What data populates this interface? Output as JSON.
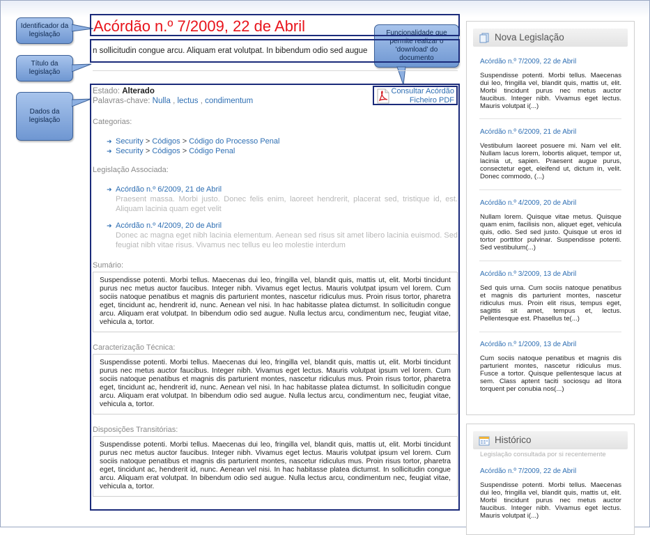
{
  "callouts": {
    "identificador": "Identificador da legislação",
    "titulo": "Título da legislação",
    "dados": "Dados da legislação",
    "funcionalidade": "Funcionalidade que permite realizar o 'download' do documento"
  },
  "document": {
    "title": "Acórdão n.º 7/2009, 22 de Abril",
    "subtitle": "n sollicitudin congue arcu. Aliquam erat volutpat. In bibendum odio sed augue",
    "estado_label": "Estado:",
    "estado_value": "Alterado",
    "keywords_label": "Palavras-chave:",
    "keywords": [
      "Nulla",
      "lectus",
      "condimentum"
    ],
    "pdf_link1": "Consultar Acórdão",
    "pdf_link2": "Ficheiro PDF",
    "categorias_label": "Categorias:",
    "categorias": [
      [
        "Security",
        "Códigos",
        "Código do Processo Penal"
      ],
      [
        "Security",
        "Códigos",
        "Código Penal"
      ]
    ],
    "associada_label": "Legislação Associada:",
    "associada": [
      {
        "title": "Acórdão n.º 6/2009, 21 de Abril",
        "desc": "Praesent massa. Morbi justo. Donec felis enim, laoreet hendrerit, placerat sed, tristique id, est. Aliquam lacinia quam eget velit"
      },
      {
        "title": "Acórdão n.º 4/2009, 20 de Abril",
        "desc": "Donec ac magna eget nibh lacinia elementum. Aenean sed risus sit amet libero lacinia euismod. Sed feugiat nibh vitae risus. Vivamus nec tellus eu leo molestie interdum"
      }
    ],
    "sumario_label": "Sumário:",
    "sumario": "Suspendisse potenti. Morbi tellus. Maecenas dui leo, fringilla vel, blandit quis, mattis ut, elit. Morbi tincidunt purus nec metus auctor faucibus. Integer nibh. Vivamus eget lectus. Mauris volutpat ipsum vel lorem. Cum sociis natoque penatibus et magnis dis parturient montes, nascetur ridiculus mus. Proin risus tortor, pharetra eget, tincidunt ac, hendrerit id, nunc. Aenean vel nisi. In hac habitasse platea dictumst. In sollicitudin congue arcu. Aliquam erat volutpat. In bibendum odio sed augue. Nulla lectus arcu, condimentum nec, feugiat vitae, vehicula a, tortor.",
    "caracterizacao_label": "Caracterização Técnica:",
    "caracterizacao": "Suspendisse potenti. Morbi tellus. Maecenas dui leo, fringilla vel, blandit quis, mattis ut, elit. Morbi tincidunt purus nec metus auctor faucibus. Integer nibh. Vivamus eget lectus. Mauris volutpat ipsum vel lorem. Cum sociis natoque penatibus et magnis dis parturient montes, nascetur ridiculus mus. Proin risus tortor, pharetra eget, tincidunt ac, hendrerit id, nunc. Aenean vel nisi. In hac habitasse platea dictumst. In sollicitudin congue arcu. Aliquam erat volutpat. In bibendum odio sed augue. Nulla lectus arcu, condimentum nec, feugiat vitae, vehicula a, tortor.",
    "disposicoes_label": "Disposições Transitórias:",
    "disposicoes": "Suspendisse potenti. Morbi tellus. Maecenas dui leo, fringilla vel, blandit quis, mattis ut, elit. Morbi tincidunt purus nec metus auctor faucibus. Integer nibh. Vivamus eget lectus. Mauris volutpat ipsum vel lorem. Cum sociis natoque penatibus et magnis dis parturient montes, nascetur ridiculus mus. Proin risus tortor, pharetra eget, tincidunt ac, hendrerit id, nunc. Aenean vel nisi. In hac habitasse platea dictumst. In sollicitudin congue arcu. Aliquam erat volutpat. In bibendum odio sed augue. Nulla lectus arcu, condimentum nec, feugiat vitae, vehicula a, tortor."
  },
  "sidebar": {
    "nova": {
      "title": "Nova Legislação",
      "icon": "pages-icon",
      "items": [
        {
          "title": "Acórdão n.º 7/2009, 22 de Abril",
          "desc": "Suspendisse potenti. Morbi tellus. Maecenas dui leo, fringilla vel, blandit quis, mattis ut, elit. Morbi tincidunt purus nec metus auctor faucibus. Integer nibh. Vivamus eget lectus. Mauris volutpat i(...)"
        },
        {
          "title": "Acórdão n.º 6/2009, 21 de Abril",
          "desc": "Vestibulum laoreet posuere mi. Nam vel elit. Nullam lacus lorem, lobortis aliquet, tempor ut, lacinia ut, sapien. Praesent augue purus, consectetur eget, eleifend ut, dictum in, velit. Donec commodo, (...)"
        },
        {
          "title": "Acórdão n.º 4/2009, 20 de Abril",
          "desc": "Nullam lorem. Quisque vitae metus. Quisque quam enim, facilisis non, aliquet eget, vehicula quis, odio. Sed sed justo. Quisque ut eros id tortor porttitor pulvinar. Suspendisse potenti. Sed vestibulum(...)"
        },
        {
          "title": "Acórdão n.º 3/2009, 13 de Abril",
          "desc": "Sed quis urna. Cum sociis natoque penatibus et magnis dis parturient montes, nascetur ridiculus mus. Proin elit risus, tempus eget, sagittis sit amet, tempus et, lectus. Pellentesque est. Phasellus te(...)"
        },
        {
          "title": "Acórdão n.º 1/2009, 13 de Abril",
          "desc": "Cum sociis natoque penatibus et magnis dis parturient montes, nascetur ridiculus mus. Fusce a tortor. Quisque pellentesque lacus at sem. Class aptent taciti sociosqu ad litora torquent per conubia nos(...)"
        }
      ]
    },
    "historico": {
      "title": "Histórico",
      "icon": "calendar-icon",
      "subtitle": "Legislação consultada por si recentemente",
      "items": [
        {
          "title": "Acórdão n.º 7/2009, 22 de Abril",
          "desc": "Suspendisse potenti. Morbi tellus. Maecenas dui leo, fringilla vel, blandit quis, mattis ut, elit. Morbi tincidunt purus nec metus auctor faucibus. Integer nibh. Vivamus eget lectus. Mauris volutpat i(...)"
        }
      ]
    }
  }
}
